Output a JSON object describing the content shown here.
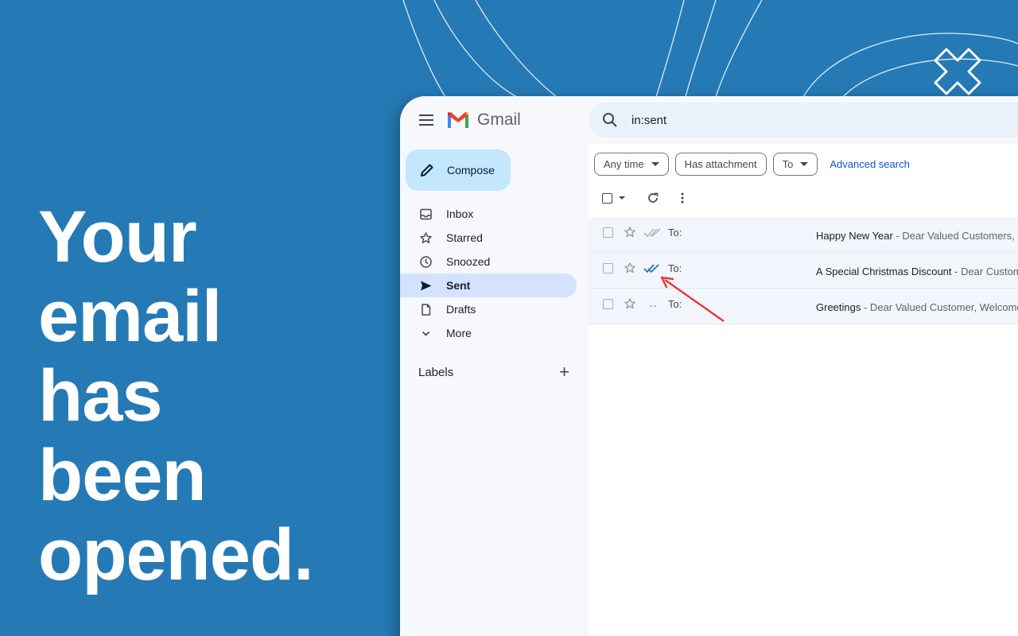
{
  "headline": [
    "Your",
    "email",
    "has",
    "been",
    "opened."
  ],
  "colors": {
    "background": "#257ab5",
    "accent": "#0b57d0",
    "active_nav": "#d3e3fd",
    "compose": "#c2e7ff",
    "arrow": "#e53935"
  },
  "app": {
    "brand": "Gmail"
  },
  "compose": {
    "label": "Compose"
  },
  "nav": [
    {
      "label": "Inbox",
      "icon": "inbox-icon"
    },
    {
      "label": "Starred",
      "icon": "star-icon"
    },
    {
      "label": "Snoozed",
      "icon": "clock-icon"
    },
    {
      "label": "Sent",
      "icon": "send-icon",
      "active": true
    },
    {
      "label": "Drafts",
      "icon": "draft-icon"
    },
    {
      "label": "More",
      "icon": "chevron-down-icon"
    }
  ],
  "labels": {
    "title": "Labels"
  },
  "search": {
    "query": "in:sent"
  },
  "filters": {
    "any_time": "Any time",
    "has_attachment": "Has attachment",
    "to": "To",
    "advanced": "Advanced search"
  },
  "emails": [
    {
      "to": "To:",
      "subject": "Happy New Year",
      "snippet": " - Dear Valued Customers, I",
      "status": "sent-unopened"
    },
    {
      "to": "To:",
      "subject": "A Special Christmas Discount",
      "snippet": " - Dear Customers",
      "status": "opened"
    },
    {
      "to": "To:",
      "subject": "Greetings",
      "snippet": " - Dear Valued Customer, Welcome",
      "status": "not-tracked"
    }
  ]
}
